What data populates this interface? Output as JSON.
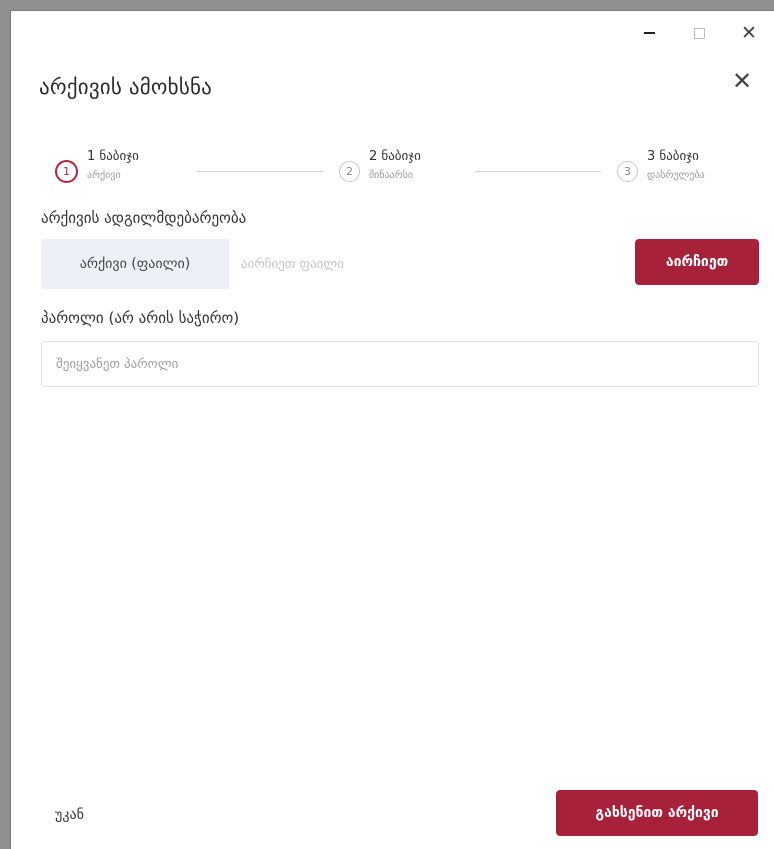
{
  "window_controls": {
    "minimize": "−",
    "maximize": "□",
    "close": "✕"
  },
  "dialog": {
    "title": "არქივის ამოხსნა",
    "close_symbol": "✕"
  },
  "steps": [
    {
      "number": "1",
      "title": "1 ნაბიჯი",
      "subtitle": "არქივი",
      "active": true
    },
    {
      "number": "2",
      "title": "2 ნაბიჯი",
      "subtitle": "შინაარსი",
      "active": false
    },
    {
      "number": "3",
      "title": "3 ნაბიჯი",
      "subtitle": "დასრულება",
      "active": false
    }
  ],
  "archive_location": {
    "label": "არქივის ადგილმდებარეობა",
    "addon": "არქივი (ფაილი)",
    "value": "",
    "placeholder": "აირჩიეთ ფაილი",
    "choose_button": "აირჩიეთ"
  },
  "password": {
    "label": "პაროლი (არ არის საჭირო)",
    "value": "",
    "placeholder": "შეიყვანეთ პაროლი"
  },
  "footer": {
    "back": "უკან",
    "extract_button": "გახსენით არქივი"
  },
  "colors": {
    "accent": "#a8213a",
    "addon_bg": "#edf1f7"
  }
}
